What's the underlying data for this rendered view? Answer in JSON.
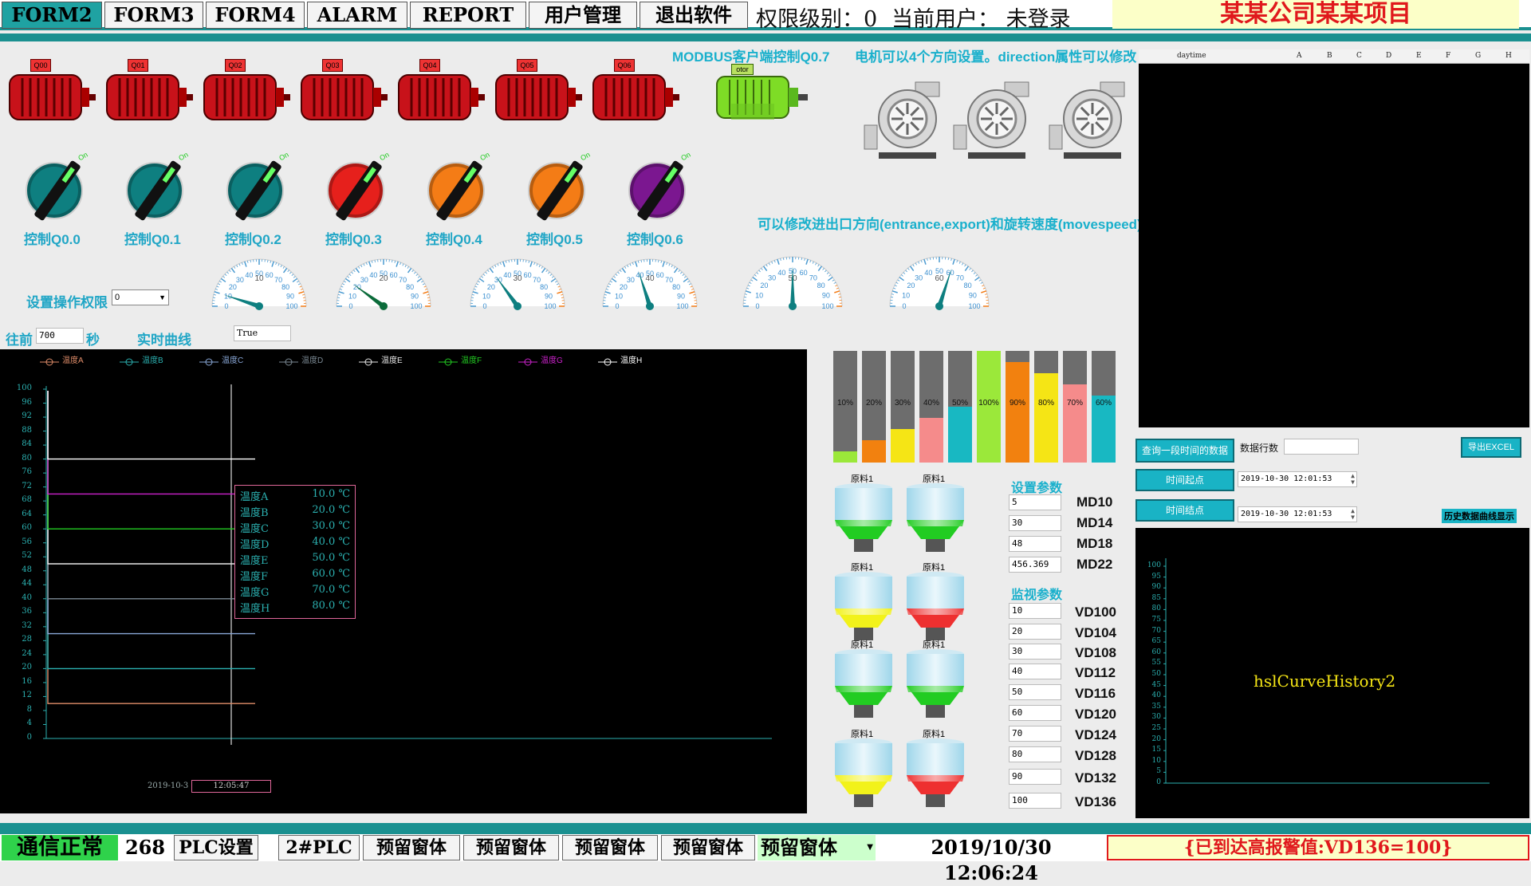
{
  "topbar": {
    "tabs": [
      "FORM2",
      "FORM3",
      "FORM4",
      "ALARM",
      "REPORT",
      "用户管理",
      "退出软件"
    ],
    "permission": "权限级别：0",
    "user": "当前用户：  未登录",
    "company": "某某公司某某项目"
  },
  "motors": {
    "tags": [
      "Q00",
      "Q01",
      "Q02",
      "Q03",
      "Q04",
      "Q05",
      "Q06"
    ],
    "modbus_title": "MODBUS客户端控制Q0.7",
    "green_tag": "otor",
    "direction_note": "电机可以4个方向设置。direction属性可以修改",
    "pump_note": "可以修改进出口方向(entrance,export)和旋转速度(movespeed)"
  },
  "knobs": [
    {
      "label": "控制Q0.0",
      "color": "#0e7f80"
    },
    {
      "label": "控制Q0.1",
      "color": "#0e7f80"
    },
    {
      "label": "控制Q0.2",
      "color": "#0e7f80"
    },
    {
      "label": "控制Q0.3",
      "color": "#e6201c"
    },
    {
      "label": "控制Q0.4",
      "color": "#f47c16"
    },
    {
      "label": "控制Q0.5",
      "color": "#f47c16"
    },
    {
      "label": "控制Q0.6",
      "color": "#7b1790"
    }
  ],
  "knob_on_text": "On",
  "gauges": [
    {
      "value": 10,
      "ticks": [
        "0",
        "10",
        "20",
        "30",
        "40",
        "50",
        "60",
        "70",
        "80",
        "90",
        "100"
      ]
    },
    {
      "value": 20,
      "ticks": [
        "0",
        "10",
        "20",
        "30",
        "40",
        "50",
        "60",
        "70",
        "80",
        "90",
        "100"
      ]
    },
    {
      "value": 30,
      "ticks": [
        "0",
        "10",
        "20",
        "30",
        "40",
        "50",
        "60",
        "70",
        "80",
        "90",
        "100"
      ]
    },
    {
      "value": 40,
      "ticks": [
        "0",
        "10",
        "20",
        "30",
        "40",
        "50",
        "60",
        "70",
        "80",
        "90",
        "100"
      ]
    },
    {
      "value": 50,
      "ticks": [
        "0",
        "10",
        "20",
        "30",
        "40",
        "50",
        "60",
        "70",
        "80",
        "90",
        "100"
      ]
    },
    {
      "value": 60,
      "ticks": [
        "0",
        "10",
        "20",
        "30",
        "40",
        "50",
        "60",
        "70",
        "80",
        "90",
        "100"
      ]
    }
  ],
  "controls": {
    "perm_label": "设置操作权限",
    "perm_value": "0",
    "back_label": "往前",
    "back_value": "700",
    "sec_label": "秒",
    "realtime_label": "实时曲线",
    "bool_value": "True"
  },
  "realtime_chart": {
    "legend": [
      {
        "name": "温度A",
        "color": "#e08d6a"
      },
      {
        "name": "温度B",
        "color": "#2bb0b0"
      },
      {
        "name": "温度C",
        "color": "#8aa8d8"
      },
      {
        "name": "温度D",
        "color": "#7c8a94"
      },
      {
        "name": "温度E",
        "color": "#e8e8e8"
      },
      {
        "name": "温度F",
        "color": "#22cc22"
      },
      {
        "name": "温度G",
        "color": "#cc22cc"
      },
      {
        "name": "温度H",
        "color": "#ffffff"
      }
    ],
    "y_ticks": [
      "100",
      "96",
      "92",
      "88",
      "84",
      "80",
      "76",
      "72",
      "68",
      "64",
      "60",
      "56",
      "52",
      "48",
      "44",
      "40",
      "36",
      "32",
      "28",
      "24",
      "20",
      "16",
      "12",
      "8",
      "4",
      "0"
    ],
    "tooltip": [
      {
        "name": "温度A",
        "value": "10.0 ℃"
      },
      {
        "name": "温度B",
        "value": "20.0 ℃"
      },
      {
        "name": "温度C",
        "value": "30.0 ℃"
      },
      {
        "name": "温度D",
        "value": "40.0 ℃"
      },
      {
        "name": "温度E",
        "value": "50.0 ℃"
      },
      {
        "name": "温度F",
        "value": "60.0 ℃"
      },
      {
        "name": "温度G",
        "value": "70.0 ℃"
      },
      {
        "name": "温度H",
        "value": "80.0 ℃"
      }
    ],
    "x_label_left": "2019-10-3",
    "x_label_cursor": "12:05:47"
  },
  "chart_data": {
    "type": "line",
    "ylim": [
      0,
      100
    ],
    "series": [
      {
        "name": "温度A",
        "value": 10
      },
      {
        "name": "温度B",
        "value": 20
      },
      {
        "name": "温度C",
        "value": 30
      },
      {
        "name": "温度D",
        "value": 40
      },
      {
        "name": "温度E",
        "value": 50
      },
      {
        "name": "温度F",
        "value": 60
      },
      {
        "name": "温度G",
        "value": 70
      },
      {
        "name": "温度H",
        "value": 80
      }
    ]
  },
  "bars": [
    {
      "pct": "10%",
      "value": 10,
      "color": "#9be83a"
    },
    {
      "pct": "20%",
      "value": 20,
      "color": "#f2810f"
    },
    {
      "pct": "30%",
      "value": 30,
      "color": "#f5e515"
    },
    {
      "pct": "40%",
      "value": 40,
      "color": "#f58b8b"
    },
    {
      "pct": "50%",
      "value": 50,
      "color": "#18b8c2"
    },
    {
      "pct": "100%",
      "value": 100,
      "color": "#9be83a"
    },
    {
      "pct": "90%",
      "value": 90,
      "color": "#f2810f"
    },
    {
      "pct": "80%",
      "value": 80,
      "color": "#f5e515"
    },
    {
      "pct": "70%",
      "value": 70,
      "color": "#f58b8b"
    },
    {
      "pct": "60%",
      "value": 60,
      "color": "#18b8c2"
    }
  ],
  "tanks": {
    "caption": "原料1",
    "colors": [
      "#22cc22",
      "#22cc22",
      "#f2f21a",
      "#ee3030",
      "#22cc22",
      "#22cc22",
      "#f2f21a",
      "#ee3030"
    ]
  },
  "params": {
    "set_title": "设置参数",
    "monitor_title": "监视参数",
    "set": [
      {
        "value": "5",
        "label": "MD10"
      },
      {
        "value": "30",
        "label": "MD14"
      },
      {
        "value": "48",
        "label": "MD18"
      },
      {
        "value": "456.369",
        "label": "MD22"
      }
    ],
    "monitor": [
      {
        "value": "10",
        "label": "VD100"
      },
      {
        "value": "20",
        "label": "VD104"
      },
      {
        "value": "30",
        "label": "VD108"
      },
      {
        "value": "40",
        "label": "VD112"
      },
      {
        "value": "50",
        "label": "VD116"
      },
      {
        "value": "60",
        "label": "VD120"
      },
      {
        "value": "70",
        "label": "VD124"
      },
      {
        "value": "80",
        "label": "VD128"
      },
      {
        "value": "90",
        "label": "VD132"
      },
      {
        "value": "100",
        "label": "VD136"
      }
    ]
  },
  "table": {
    "columns": [
      "daytime",
      "A",
      "B",
      "C",
      "D",
      "E",
      "F",
      "G",
      "H"
    ]
  },
  "history": {
    "query_button": "查询一段时间的数据",
    "rows_label": "数据行数",
    "export_button": "导出EXCEL",
    "start_button": "时间起点",
    "end_button": "时间结点",
    "start_value": "2019-10-30  12:01:53",
    "end_value": "2019-10-30  12:01:53",
    "curve_note": "历史数据曲线显示",
    "placeholder": "hslCurveHistory2",
    "y_ticks": [
      "100",
      "95",
      "90",
      "85",
      "80",
      "75",
      "70",
      "65",
      "60",
      "55",
      "50",
      "45",
      "40",
      "35",
      "30",
      "25",
      "20",
      "15",
      "10",
      "5",
      "0"
    ]
  },
  "status": {
    "comm": "通信正常",
    "count": "268",
    "buttons": [
      "PLC设置",
      "2#PLC",
      "预留窗体",
      "预留窗体",
      "预留窗体",
      "预留窗体"
    ],
    "combo": "预留窗体",
    "datetime": "2019/10/30 12:06:24",
    "alarm": "{已到达高报警值:VD136=100}"
  }
}
